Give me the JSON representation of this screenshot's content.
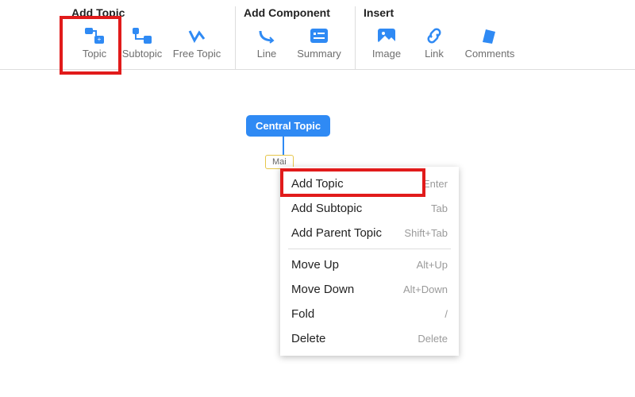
{
  "toolbar": {
    "groups": {
      "addTopic": {
        "title": "Add Topic",
        "buttons": {
          "topic": "Topic",
          "subtopic": "Subtopic",
          "freetopic": "Free Topic"
        }
      },
      "addComponent": {
        "title": "Add Component",
        "buttons": {
          "line": "Line",
          "summary": "Summary"
        }
      },
      "insert": {
        "title": "Insert",
        "buttons": {
          "image": "Image",
          "link": "Link",
          "comments": "Comments"
        }
      }
    }
  },
  "canvas": {
    "central": "Central Topic",
    "mainNode": "Mai"
  },
  "contextMenu": {
    "items": [
      {
        "label": "Add Topic",
        "shortcut": "Enter"
      },
      {
        "label": "Add Subtopic",
        "shortcut": "Tab"
      },
      {
        "label": "Add Parent Topic",
        "shortcut": "Shift+Tab"
      },
      {
        "label": "Move Up",
        "shortcut": "Alt+Up"
      },
      {
        "label": "Move Down",
        "shortcut": "Alt+Down"
      },
      {
        "label": "Fold",
        "shortcut": "/"
      },
      {
        "label": "Delete",
        "shortcut": "Delete"
      }
    ]
  }
}
